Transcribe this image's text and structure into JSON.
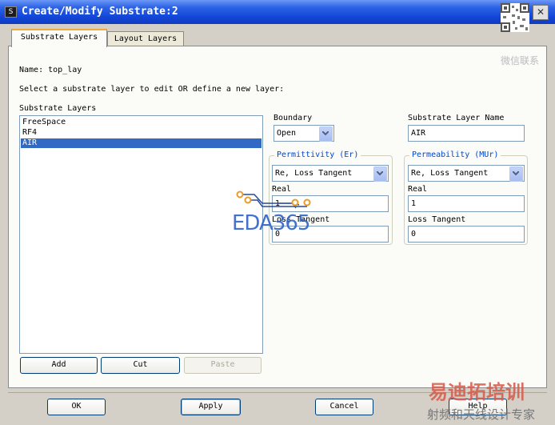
{
  "window": {
    "title": "Create/Modify Substrate:2",
    "close_symbol": "✕"
  },
  "tabs": [
    {
      "label": "Substrate Layers",
      "active": true
    },
    {
      "label": "Layout Layers",
      "active": false
    }
  ],
  "name_line": "Name: top_lay",
  "instruction": "Select a substrate layer to edit OR define a new layer:",
  "substrate_layers": {
    "label": "Substrate Layers",
    "items": [
      "FreeSpace",
      "RF4",
      "AIR"
    ],
    "selected_index": 2
  },
  "list_buttons": {
    "add": "Add",
    "cut": "Cut",
    "paste": "Paste"
  },
  "boundary": {
    "label": "Boundary",
    "value": "Open"
  },
  "layer_name": {
    "label": "Substrate Layer Name",
    "value": "AIR"
  },
  "permittivity": {
    "title": "Permittivity (Er)",
    "mode": "Re, Loss Tangent",
    "real_label": "Real",
    "real_value": "1",
    "loss_label": "Loss Tangent",
    "loss_value": "0"
  },
  "permeability": {
    "title": "Permeability (MUr)",
    "mode": "Re, Loss Tangent",
    "real_label": "Real",
    "real_value": "1",
    "loss_label": "Loss Tangent",
    "loss_value": "0"
  },
  "footer_buttons": {
    "ok": "OK",
    "apply": "Apply",
    "cancel": "Cancel",
    "help": "Help"
  },
  "watermarks": {
    "eda_logo": "EDA365",
    "wechat_caption": "微信联系",
    "cn_brand": "易迪拓培训",
    "cn_tagline": "射频和天线设计专家"
  },
  "colors": {
    "title_bar": "#1346d8",
    "selection": "#316ac5",
    "group_title": "#0046d5",
    "tab_accent": "#f2a93b"
  }
}
